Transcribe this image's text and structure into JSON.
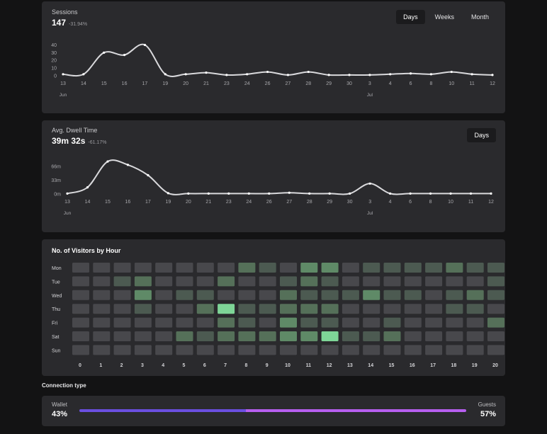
{
  "sessions": {
    "label": "Sessions",
    "value": "147",
    "delta": "-31.94%",
    "range_options": [
      "Days",
      "Weeks",
      "Month"
    ],
    "active_range": "Days"
  },
  "dwell": {
    "label": "Avg. Dwell Time",
    "value": "39m 32s",
    "delta": "-61.17%",
    "range_options": [
      "Days"
    ],
    "active_range": "Days"
  },
  "heatmap": {
    "title": "No. of Visitors by Hour"
  },
  "connection": {
    "section_label": "Connection type",
    "left_name": "Wallet",
    "left_pct": "43%",
    "right_name": "Guests",
    "right_pct": "57%",
    "left_color": "#6b4fe0",
    "right_color": "#b75ff0"
  },
  "chart_data": [
    {
      "type": "line",
      "x": [
        "13",
        "14",
        "15",
        "16",
        "17",
        "19",
        "20",
        "21",
        "23",
        "24",
        "26",
        "27",
        "28",
        "29",
        "30",
        "3",
        "4",
        "6",
        "8",
        "10",
        "11",
        "12"
      ],
      "month_labels": [
        {
          "label": "Jun",
          "at": "13"
        },
        {
          "label": "Jul",
          "at": "3"
        }
      ],
      "y_ticks": [
        "40",
        "30",
        "20",
        "10",
        "0"
      ],
      "ylim": [
        0,
        45
      ],
      "values": [
        2,
        2,
        30,
        27,
        40,
        2,
        2,
        4,
        1,
        2,
        5,
        1,
        5,
        1,
        1,
        1,
        2,
        3,
        2,
        5,
        2,
        1
      ],
      "color": "#d9d9dc"
    },
    {
      "type": "line",
      "x": [
        "13",
        "14",
        "15",
        "16",
        "17",
        "19",
        "20",
        "21",
        "23",
        "24",
        "26",
        "27",
        "28",
        "29",
        "30",
        "3",
        "4",
        "6",
        "8",
        "10",
        "11",
        "12"
      ],
      "month_labels": [
        {
          "label": "Jun",
          "at": "13"
        },
        {
          "label": "Jul",
          "at": "3"
        }
      ],
      "y_ticks": [
        "66m",
        "33m",
        "0m"
      ],
      "y_tick_values": [
        66,
        33,
        0
      ],
      "ylim": [
        0,
        85
      ],
      "values": [
        1,
        16,
        78,
        70,
        45,
        2,
        1,
        1,
        1,
        1,
        1,
        3,
        1,
        1,
        1,
        25,
        1,
        1,
        1,
        1,
        1,
        1
      ],
      "color": "#d9d9dc"
    },
    {
      "type": "heatmap",
      "rows": [
        "Mon",
        "Tue",
        "Wed",
        "Thu",
        "Fri",
        "Sat",
        "Sun"
      ],
      "columns": [
        "0",
        "1",
        "2",
        "3",
        "4",
        "5",
        "6",
        "7",
        "8",
        "9",
        "10",
        "11",
        "12",
        "13",
        "14",
        "15",
        "16",
        "17",
        "18",
        "19",
        "20"
      ],
      "col_labels": [
        "0",
        "1",
        "2",
        "3",
        "4",
        "5",
        "6",
        "7",
        "8",
        "9",
        "10",
        "11",
        "12",
        "13",
        "14",
        "15",
        "16",
        "17",
        "18",
        "19",
        "20"
      ],
      "values": [
        [
          0,
          0,
          0,
          0,
          0,
          0,
          0,
          0,
          2,
          1,
          0,
          3,
          3,
          0,
          1,
          1,
          1,
          1,
          2,
          1,
          1
        ],
        [
          0,
          0,
          1,
          2,
          0,
          0,
          0,
          2,
          0,
          0,
          1,
          2,
          1,
          0,
          0,
          0,
          0,
          0,
          0,
          0,
          1
        ],
        [
          0,
          0,
          0,
          3,
          0,
          1,
          1,
          0,
          0,
          0,
          2,
          1,
          1,
          1,
          3,
          1,
          1,
          0,
          1,
          2,
          1
        ],
        [
          0,
          0,
          0,
          1,
          0,
          0,
          2,
          5,
          1,
          1,
          2,
          2,
          2,
          0,
          0,
          0,
          0,
          0,
          1,
          1,
          0
        ],
        [
          0,
          0,
          0,
          0,
          0,
          0,
          0,
          2,
          1,
          0,
          3,
          1,
          1,
          0,
          0,
          1,
          0,
          0,
          0,
          0,
          2
        ],
        [
          0,
          0,
          0,
          0,
          0,
          2,
          1,
          2,
          2,
          2,
          3,
          3,
          5,
          1,
          1,
          2,
          0,
          0,
          0,
          0,
          0
        ],
        [
          0,
          0,
          0,
          0,
          0,
          0,
          0,
          0,
          0,
          0,
          0,
          0,
          0,
          0,
          0,
          0,
          0,
          0,
          0,
          0,
          0
        ]
      ],
      "max_value": 5
    }
  ]
}
